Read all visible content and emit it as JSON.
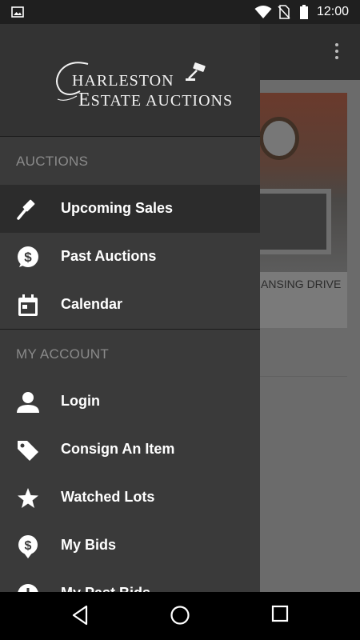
{
  "status_bar": {
    "time": "12:00"
  },
  "background": {
    "card_text": "ANSING DRIVE"
  },
  "drawer": {
    "logo": {
      "line1": "HARLESTON",
      "line1_initial": "C",
      "line2": "STATE AUCTIONS",
      "line2_initial": "E"
    },
    "sections": [
      {
        "label": "AUCTIONS",
        "items": [
          {
            "label": "Upcoming Sales",
            "icon": "gavel-icon",
            "selected": true
          },
          {
            "label": "Past Auctions",
            "icon": "dollar-bubble-icon"
          },
          {
            "label": "Calendar",
            "icon": "calendar-icon"
          }
        ]
      },
      {
        "label": "MY ACCOUNT",
        "items": [
          {
            "label": "Login",
            "icon": "person-icon"
          },
          {
            "label": "Consign An Item",
            "icon": "tag-icon"
          },
          {
            "label": "Watched Lots",
            "icon": "star-icon"
          },
          {
            "label": "My Bids",
            "icon": "dollar-pin-icon"
          },
          {
            "label": "My Past Bids",
            "icon": "info-circle-icon"
          }
        ]
      }
    ]
  },
  "colors": {
    "drawer_bg": "#3a3a3a",
    "selected_bg": "#2c2c2c",
    "section_label": "#8a8a8a"
  }
}
